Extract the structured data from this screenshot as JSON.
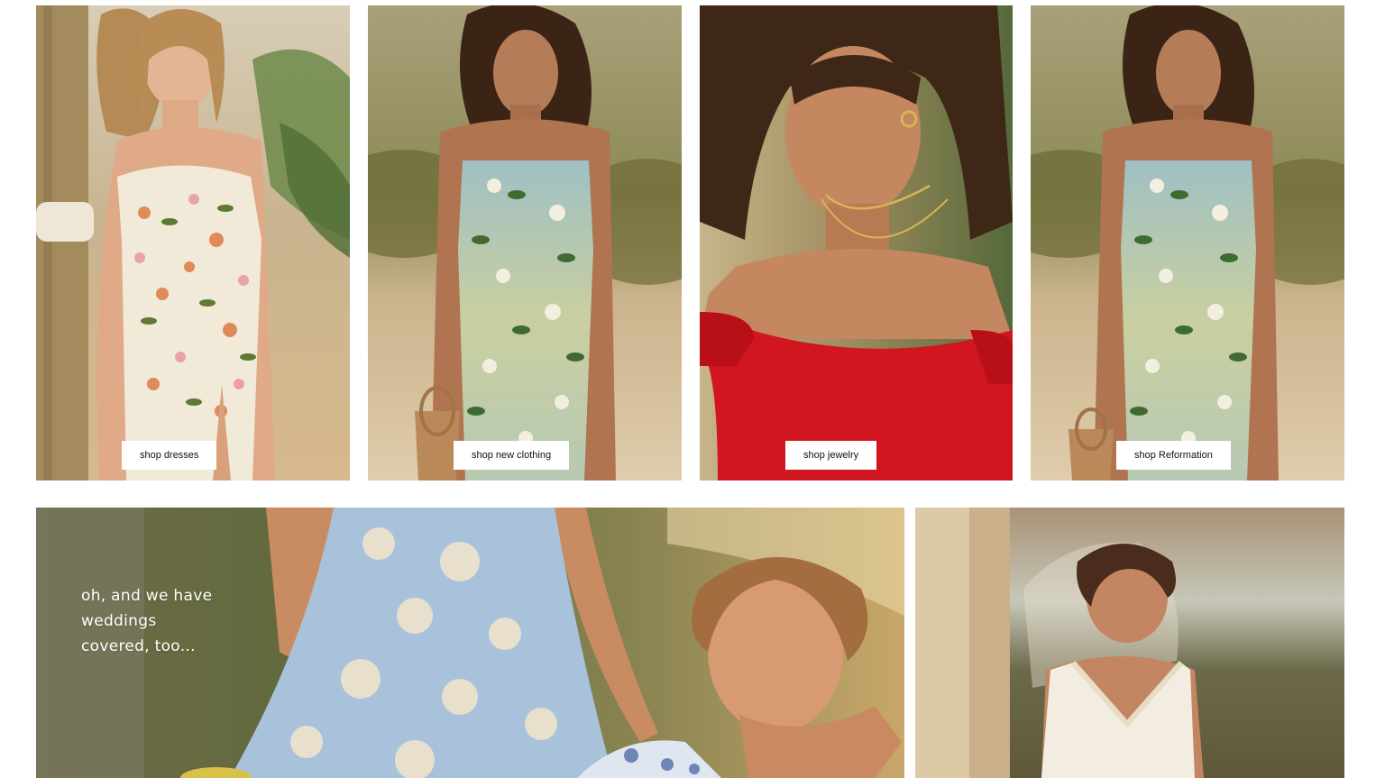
{
  "tiles": [
    {
      "id": "dresses",
      "button_label": "shop dresses",
      "image_alt": "Model in cream floral print midi dress"
    },
    {
      "id": "new-clothing",
      "button_label": "shop new clothing",
      "image_alt": "Model in blue and green floral dress with woven bag"
    },
    {
      "id": "jewelry",
      "button_label": "shop jewelry",
      "image_alt": "Model in red off-shoulder top wearing gold necklaces"
    },
    {
      "id": "reformation",
      "button_label": "shop Reformation",
      "image_alt": "Model in blue and green floral dress on beach"
    }
  ],
  "weddings": {
    "headline": "oh, and we have weddings covered, too...",
    "image_alt_left": "Guests in floral dresses at golden hour",
    "image_alt_right": "Bride in lace-trimmed white dress with veil"
  },
  "colors": {
    "button_bg": "#ffffff",
    "button_text": "#111111",
    "page_bg": "#ffffff",
    "dress_red": "#d2161f"
  }
}
